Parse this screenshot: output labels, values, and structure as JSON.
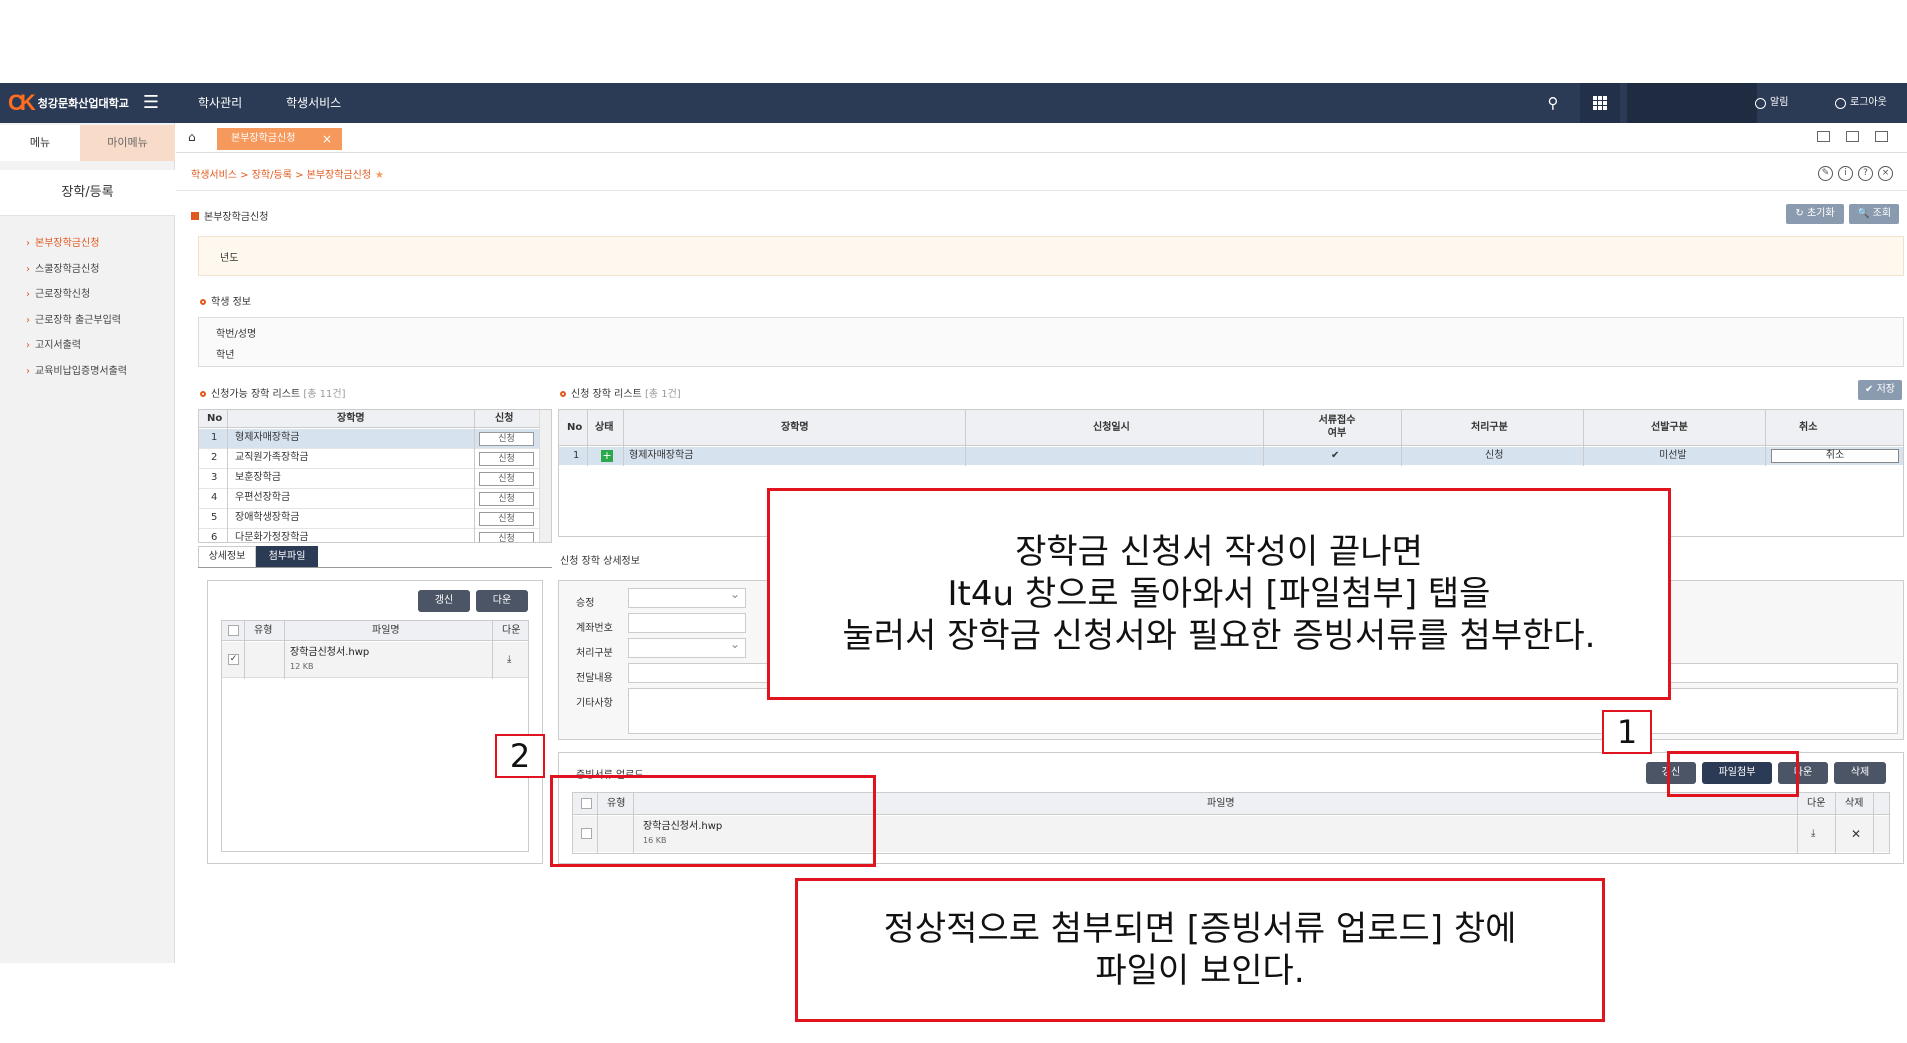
{
  "header": {
    "logo_mark": "CK",
    "school_name": "청강문화산업대학교",
    "menus": [
      "학사관리",
      "학생서비스"
    ],
    "notify_label": "알림",
    "logout_label": "로그아웃"
  },
  "sidebar": {
    "tabs": [
      "메뉴",
      "마이메뉴"
    ],
    "title": "장학/등록",
    "items": [
      {
        "label": "본부장학금신청",
        "active": true
      },
      {
        "label": "스쿨장학금신청",
        "active": false
      },
      {
        "label": "근로장학신청",
        "active": false
      },
      {
        "label": "근로장학 출근부입력",
        "active": false
      },
      {
        "label": "고지서출력",
        "active": false
      },
      {
        "label": "교육비납입증명서출력",
        "active": false
      }
    ]
  },
  "page_tab": {
    "label": "본부장학금신청",
    "close": "×"
  },
  "breadcrumb": "학생서비스 > 장학/등록 > 본부장학금신청",
  "page_title": "본부장학금신청",
  "top_buttons": {
    "reset": "↻ 초기화",
    "search": "🔍 조회",
    "save": "✔ 저장"
  },
  "notice_label": "년도",
  "student_section": {
    "title": "학생 정보",
    "labels": [
      "학번/성명",
      "학년"
    ]
  },
  "available_list": {
    "title": "신청가능 장학 리스트",
    "count": "[총 11건]",
    "headers": [
      "No",
      "장학명",
      "신청"
    ],
    "apply_label": "신청",
    "rows": [
      {
        "no": "1",
        "name": "형제자매장학금"
      },
      {
        "no": "2",
        "name": "교직원가족장학금"
      },
      {
        "no": "3",
        "name": "보훈장학금"
      },
      {
        "no": "4",
        "name": "우편선장학금"
      },
      {
        "no": "5",
        "name": "장애학생장학금"
      },
      {
        "no": "6",
        "name": "다문화가정장학금"
      }
    ]
  },
  "applied_list": {
    "title": "신청 장학 리스트",
    "count": "[총 1건]",
    "headers": [
      "No",
      "상태",
      "장학명",
      "신청일시",
      "서류접수\n여부",
      "처리구분",
      "선발구분",
      "취소"
    ],
    "row": {
      "no": "1",
      "name": "형제자매장학금",
      "doc": "✔",
      "proc": "신청",
      "select": "미선발",
      "cancel": "취소"
    }
  },
  "detail_tabs": [
    "상세정보",
    "첨부파일"
  ],
  "attach_panel": {
    "buttons": [
      "갱신",
      "다운"
    ],
    "headers": [
      "유형",
      "파일명",
      "다운"
    ],
    "file": {
      "name": "장학금신청서.hwp",
      "size": "12 KB"
    }
  },
  "detail_form": {
    "title": "신청 장학 상세정보",
    "labels": [
      "승정",
      "계좌번호",
      "처리구분",
      "전달내용",
      "기타사항"
    ]
  },
  "upload_section": {
    "title": "증빙서류 업로드",
    "buttons": [
      "갱신",
      "파일첨부",
      "다운",
      "삭제"
    ],
    "headers": [
      "유형",
      "파일명",
      "다운",
      "삭제"
    ],
    "file": {
      "name": "장학금신청서.hwp",
      "size": "16 KB"
    }
  },
  "annotations": {
    "callout1": [
      "장학금 신청서 작성이 끝나면",
      "It4u 창으로 돌아와서 [파일첨부] 탭을",
      "눌러서 장학금 신청서와 필요한 증빙서류를 첨부한다."
    ],
    "callout2": [
      "정상적으로 첨부되면 [증빙서류 업로드] 창에",
      "파일이 보인다."
    ],
    "num1": "1",
    "num2": "2"
  },
  "colors": {
    "navy": "#2b3a55",
    "accent": "#e05a1e",
    "annotation_red": "#e0141e"
  }
}
